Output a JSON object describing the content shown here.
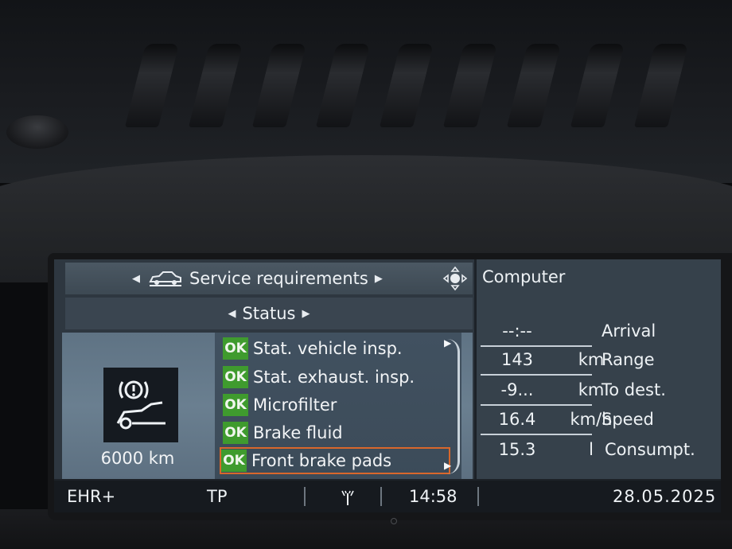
{
  "header": {
    "section_title": "Service requirements",
    "subsection_title": "Status",
    "computer_title": "Computer"
  },
  "service_items": [
    {
      "status": "OK",
      "label": "Stat. vehicle insp."
    },
    {
      "status": "OK",
      "label": "Stat. exhaust. insp."
    },
    {
      "status": "OK",
      "label": "Microfilter"
    },
    {
      "status": "OK",
      "label": "Brake fluid"
    },
    {
      "status": "OK",
      "label": "Front brake pads",
      "selected": true
    }
  ],
  "selected_item_detail": {
    "icon": "brake-pad-warning-icon",
    "distance": "6000 km"
  },
  "computer": {
    "rows": [
      {
        "value": "--:--",
        "unit": "",
        "label": "Arrival"
      },
      {
        "value": "143",
        "unit": "km",
        "label": "Range"
      },
      {
        "value": "-9...",
        "unit": "km",
        "label": "To dest."
      },
      {
        "value": "16.4",
        "unit": "km/h",
        "label": "Speed"
      },
      {
        "value": "15.3",
        "unit": "l",
        "label": "Consumpt."
      }
    ]
  },
  "status_bar": {
    "radio": "EHR+",
    "traffic": "TP",
    "signal_icon": "antenna-icon",
    "time": "14:58",
    "date": "28.05.2025"
  },
  "colors": {
    "ok_badge": "#3f9b2e",
    "selection_border": "#d8672c",
    "screen_background": "#2e3740"
  }
}
